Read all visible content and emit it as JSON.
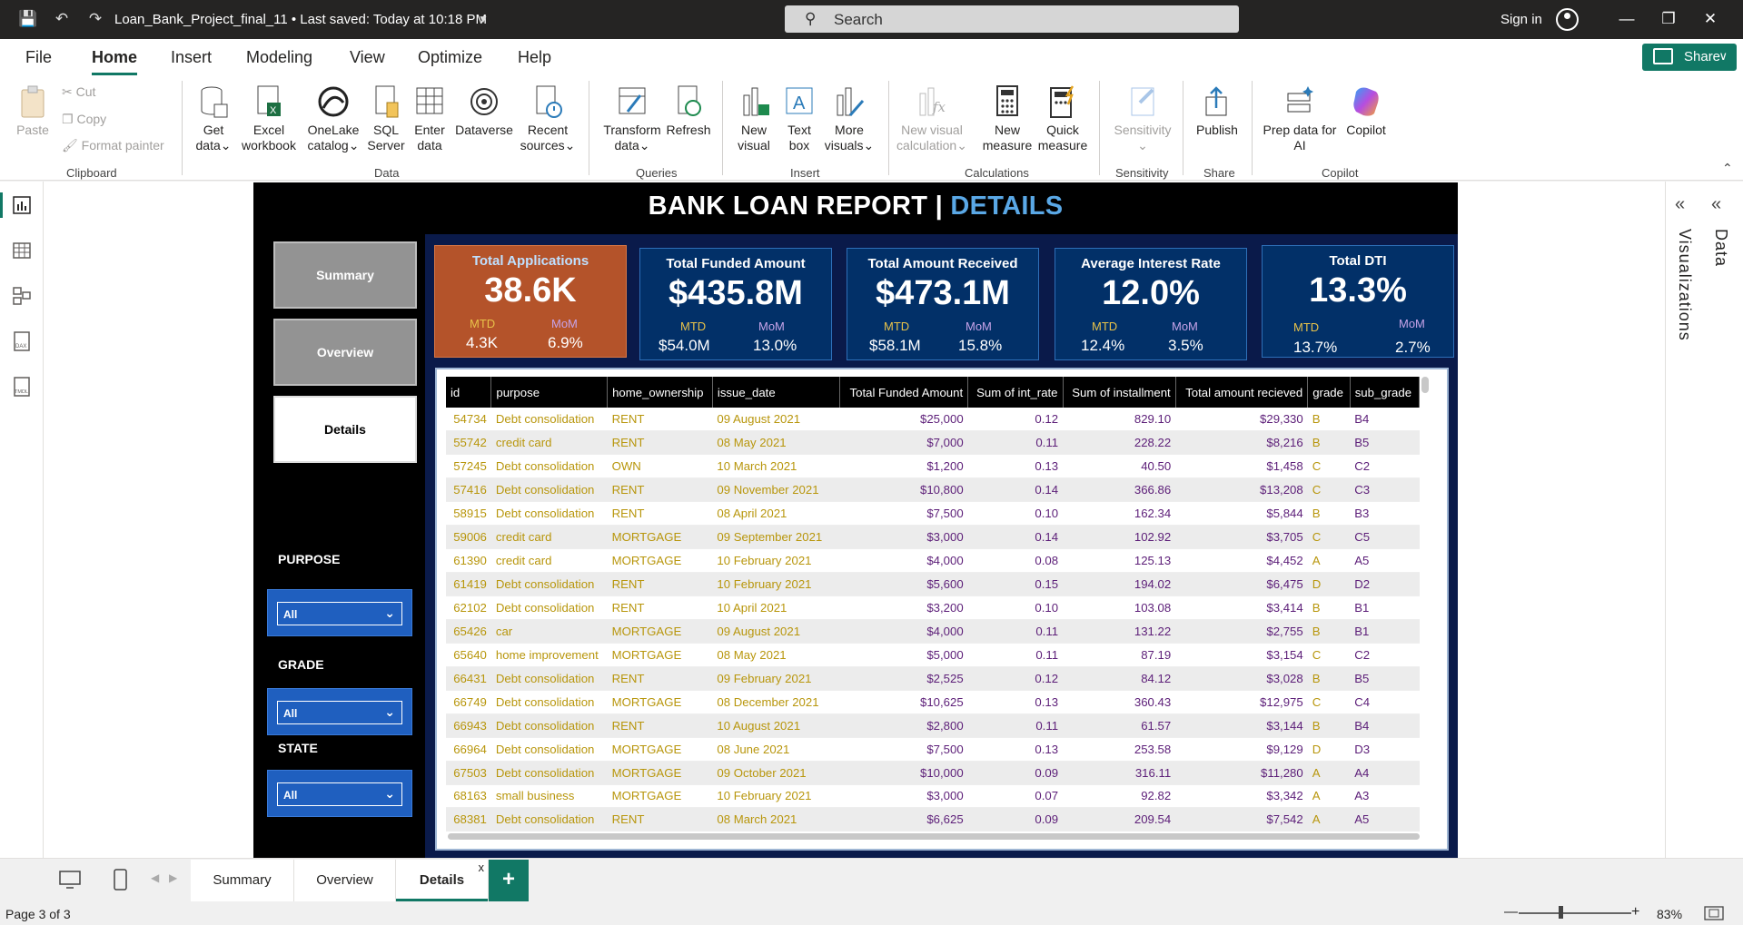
{
  "titlebar": {
    "file_title": "Loan_Bank_Project_final_11  •  Last saved: Today at 10:18 PM",
    "search_placeholder": "Search",
    "sign_in": "Sign in"
  },
  "menu": {
    "tabs": [
      "File",
      "Home",
      "Insert",
      "Modeling",
      "View",
      "Optimize",
      "Help"
    ],
    "active": "Home",
    "share_label": "Share"
  },
  "ribbon": {
    "paste": "Paste",
    "cut": "Cut",
    "copy": "Copy",
    "format_painter": "Format painter",
    "get_data": [
      "Get",
      "data"
    ],
    "excel": [
      "Excel",
      "workbook"
    ],
    "onelake": [
      "OneLake",
      "catalog"
    ],
    "sql": [
      "SQL",
      "Server"
    ],
    "enter_data": [
      "Enter",
      "data"
    ],
    "dataverse": "Dataverse",
    "recent": [
      "Recent",
      "sources"
    ],
    "transform": [
      "Transform",
      "data"
    ],
    "refresh": "Refresh",
    "new_visual": [
      "New",
      "visual"
    ],
    "text_box": [
      "Text",
      "box"
    ],
    "more_visuals": [
      "More",
      "visuals"
    ],
    "new_visual_calc": [
      "New visual",
      "calculation"
    ],
    "new_measure": [
      "New",
      "measure"
    ],
    "quick_measure": [
      "Quick",
      "measure"
    ],
    "sensitivity": "Sensitivity",
    "publish": "Publish",
    "prep_ai": [
      "Prep data for",
      "AI"
    ],
    "copilot": "Copilot",
    "groups": {
      "clipboard": "Clipboard",
      "data": "Data",
      "queries": "Queries",
      "insert": "Insert",
      "calculations": "Calculations",
      "sensitivity": "Sensitivity",
      "share": "Share",
      "copilot": "Copilot"
    }
  },
  "report": {
    "title_main": "BANK LOAN REPORT | ",
    "title_hl": "DETAILS",
    "nav": [
      "Summary",
      "Overview",
      "Details"
    ],
    "slicers": [
      {
        "label": "PURPOSE",
        "value": "All"
      },
      {
        "label": "GRADE",
        "value": "All"
      },
      {
        "label": "STATE",
        "value": "All"
      }
    ],
    "kpis": [
      {
        "title": "Total Applications",
        "value": "38.6K",
        "mtd_label": "MTD",
        "mtd": "4.3K",
        "mom_label": "MoM",
        "mom": "6.9%"
      },
      {
        "title": "Total Funded Amount",
        "value": "$435.8M",
        "mtd_label": "MTD",
        "mtd": "$54.0M",
        "mom_label": "MoM",
        "mom": "13.0%"
      },
      {
        "title": "Total Amount Received",
        "value": "$473.1M",
        "mtd_label": "MTD",
        "mtd": "$58.1M",
        "mom_label": "MoM",
        "mom": "15.8%"
      },
      {
        "title": "Average Interest Rate",
        "value": "12.0%",
        "mtd_label": "MTD",
        "mtd": "12.4%",
        "mom_label": "MoM",
        "mom": "3.5%"
      },
      {
        "title": "Total DTI",
        "value": "13.3%",
        "mtd_label": "MTD",
        "mtd": "13.7%",
        "mom_label": "MoM",
        "mom": "2.7%"
      }
    ],
    "table": {
      "columns": [
        "id",
        "purpose",
        "home_ownership",
        "issue_date",
        "Total Funded Amount",
        "Sum of int_rate",
        "Sum of installment",
        "Total amount recieved",
        "grade",
        "sub_grade"
      ],
      "rows": [
        [
          "54734",
          "Debt consolidation",
          "RENT",
          "09 August 2021",
          "$25,000",
          "0.12",
          "829.10",
          "$29,330",
          "B",
          "B4"
        ],
        [
          "55742",
          "credit card",
          "RENT",
          "08 May 2021",
          "$7,000",
          "0.11",
          "228.22",
          "$8,216",
          "B",
          "B5"
        ],
        [
          "57245",
          "Debt consolidation",
          "OWN",
          "10 March 2021",
          "$1,200",
          "0.13",
          "40.50",
          "$1,458",
          "C",
          "C2"
        ],
        [
          "57416",
          "Debt consolidation",
          "RENT",
          "09 November 2021",
          "$10,800",
          "0.14",
          "366.86",
          "$13,208",
          "C",
          "C3"
        ],
        [
          "58915",
          "Debt consolidation",
          "RENT",
          "08 April 2021",
          "$7,500",
          "0.10",
          "162.34",
          "$5,844",
          "B",
          "B3"
        ],
        [
          "59006",
          "credit card",
          "MORTGAGE",
          "09 September 2021",
          "$3,000",
          "0.14",
          "102.92",
          "$3,705",
          "C",
          "C5"
        ],
        [
          "61390",
          "credit card",
          "MORTGAGE",
          "10 February 2021",
          "$4,000",
          "0.08",
          "125.13",
          "$4,452",
          "A",
          "A5"
        ],
        [
          "61419",
          "Debt consolidation",
          "RENT",
          "10 February 2021",
          "$5,600",
          "0.15",
          "194.02",
          "$6,475",
          "D",
          "D2"
        ],
        [
          "62102",
          "Debt consolidation",
          "RENT",
          "10 April 2021",
          "$3,200",
          "0.10",
          "103.08",
          "$3,414",
          "B",
          "B1"
        ],
        [
          "65426",
          "car",
          "MORTGAGE",
          "09 August 2021",
          "$4,000",
          "0.11",
          "131.22",
          "$2,755",
          "B",
          "B1"
        ],
        [
          "65640",
          "home improvement",
          "MORTGAGE",
          "08 May 2021",
          "$5,000",
          "0.11",
          "87.19",
          "$3,154",
          "C",
          "C2"
        ],
        [
          "66431",
          "Debt consolidation",
          "RENT",
          "09 February 2021",
          "$2,525",
          "0.12",
          "84.12",
          "$3,028",
          "B",
          "B5"
        ],
        [
          "66749",
          "Debt consolidation",
          "MORTGAGE",
          "08 December 2021",
          "$10,625",
          "0.13",
          "360.43",
          "$12,975",
          "C",
          "C4"
        ],
        [
          "66943",
          "Debt consolidation",
          "RENT",
          "10 August 2021",
          "$2,800",
          "0.11",
          "61.57",
          "$3,144",
          "B",
          "B4"
        ],
        [
          "66964",
          "Debt consolidation",
          "MORTGAGE",
          "08 June 2021",
          "$7,500",
          "0.13",
          "253.58",
          "$9,129",
          "D",
          "D3"
        ],
        [
          "67503",
          "Debt consolidation",
          "MORTGAGE",
          "09 October 2021",
          "$10,000",
          "0.09",
          "316.11",
          "$11,280",
          "A",
          "A4"
        ],
        [
          "68163",
          "small business",
          "MORTGAGE",
          "10 February 2021",
          "$3,000",
          "0.07",
          "92.82",
          "$3,342",
          "A",
          "A3"
        ],
        [
          "68381",
          "Debt consolidation",
          "RENT",
          "08 March 2021",
          "$6,625",
          "0.09",
          "209.54",
          "$7,542",
          "A",
          "A5"
        ]
      ]
    }
  },
  "panes": {
    "visualizations": "Visualizations",
    "data": "Data"
  },
  "pages": {
    "tabs": [
      "Summary",
      "Overview",
      "Details"
    ],
    "active": "Details"
  },
  "status": {
    "page": "Page 3 of 3",
    "zoom": "83%"
  }
}
